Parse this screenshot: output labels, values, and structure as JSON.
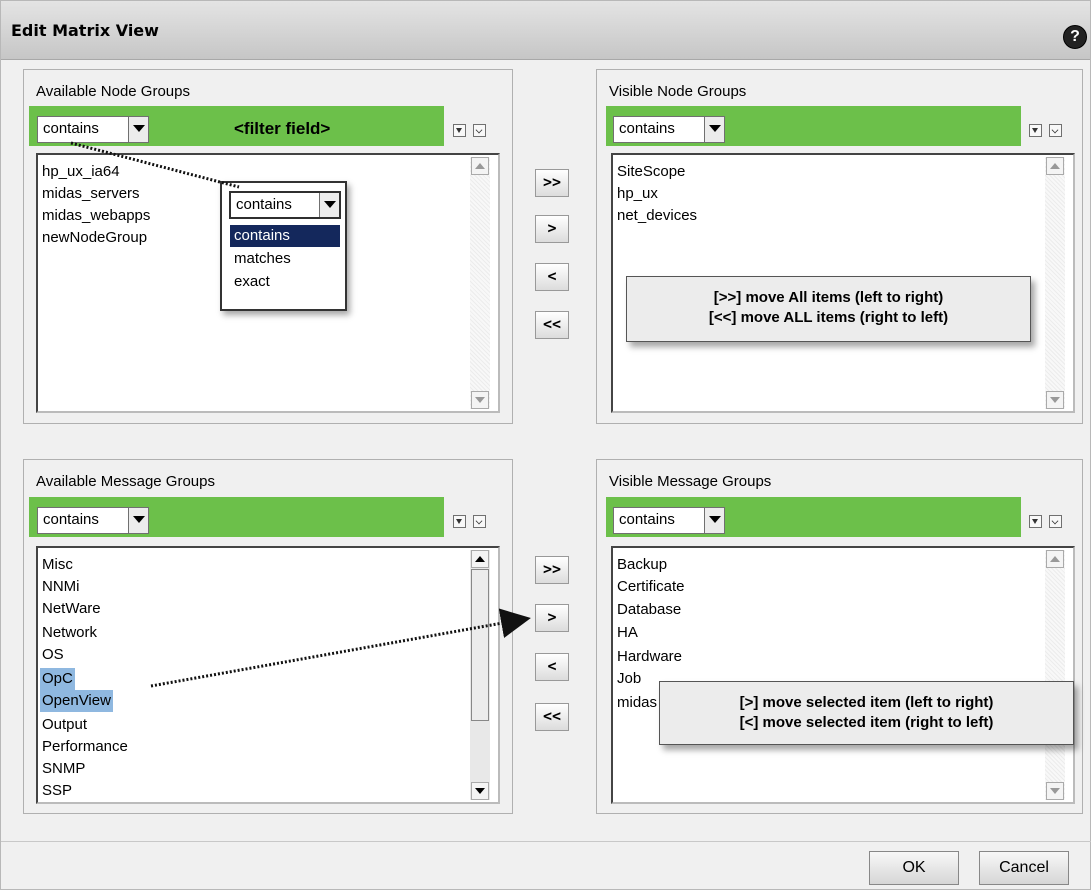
{
  "dialog": {
    "title": "Edit Matrix View",
    "help": "?"
  },
  "filter_label": "<filter field>",
  "moves": {
    "all_right": ">>",
    "right": ">",
    "left": "<",
    "all_left": "<<"
  },
  "available_node": {
    "label": "Available Node Groups",
    "filter": "contains",
    "items": [
      "hp_ux_ia64",
      "midas_servers",
      "midas_webapps",
      "newNodeGroup"
    ]
  },
  "filter_dropdown": {
    "selected": "contains",
    "options": [
      "contains",
      "matches",
      "exact"
    ]
  },
  "visible_node": {
    "label": "Visible Node Groups",
    "filter": "contains",
    "items": [
      "SiteScope",
      "hp_ux",
      "net_devices"
    ]
  },
  "available_msg": {
    "label": "Available Message Groups",
    "filter": "contains",
    "items": [
      "Misc",
      "NNMi",
      "NetWare",
      "Network",
      "OS",
      "OpC",
      "OpenView",
      "Output",
      "Performance",
      "SNMP",
      "SSP"
    ]
  },
  "visible_msg": {
    "label": "Visible Message Groups",
    "filter": "contains",
    "items": [
      "Backup",
      "Certificate",
      "Database",
      "HA",
      "Hardware",
      "Job",
      "midas"
    ]
  },
  "callout_all": {
    "line1": "[>>] move All items (left to right)",
    "line2": "[<<] move ALL items (right to left)"
  },
  "callout_sel": {
    "line1": "[>] move selected item (left to right)",
    "line2": "[<] move selected item (right to left)"
  },
  "footer": {
    "ok": "OK",
    "cancel": "Cancel"
  }
}
